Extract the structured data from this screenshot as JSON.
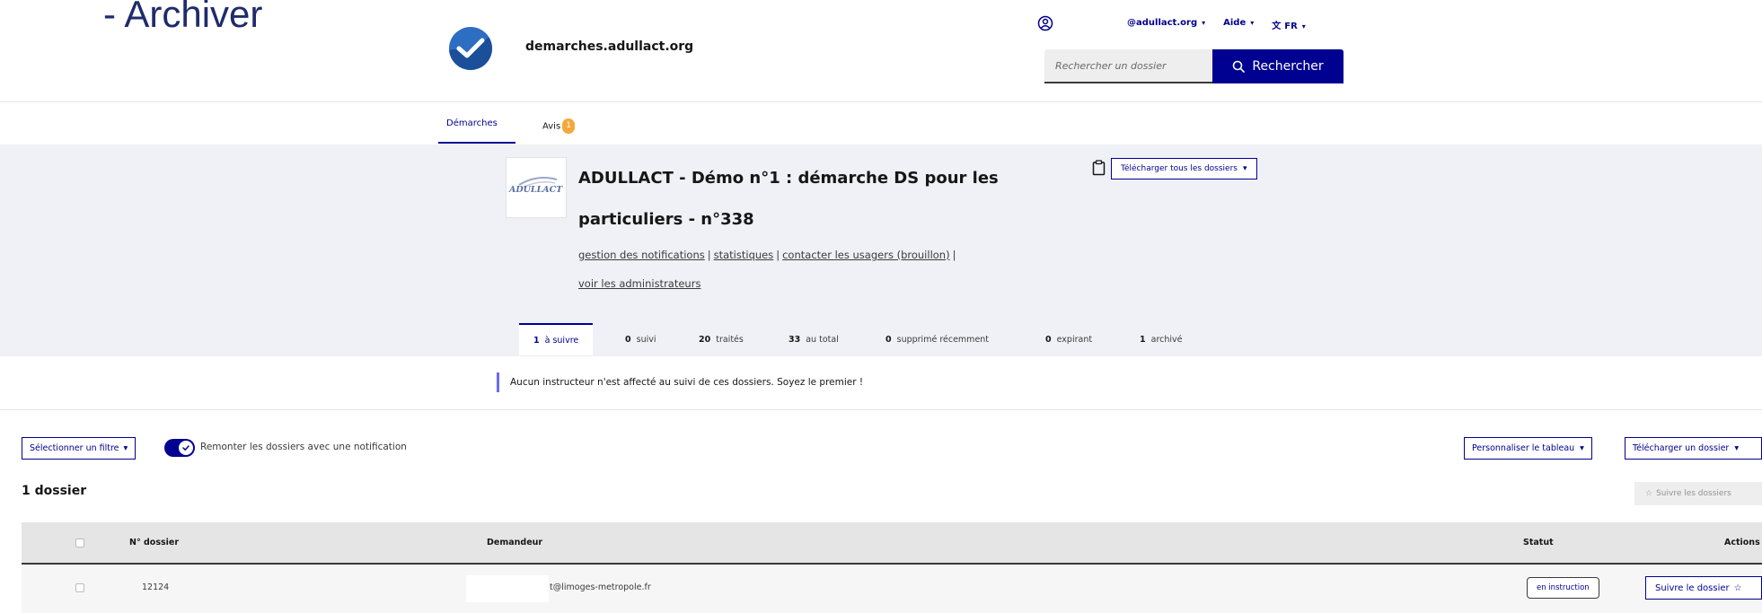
{
  "slide": {
    "title": "- Archiver"
  },
  "header": {
    "site_name": "demarches.adullact.org",
    "account_menu": "@adullact.org",
    "help_menu": "Aide",
    "language_menu": "FR",
    "search": {
      "placeholder": "Rechercher un dossier",
      "button_label": "Rechercher"
    }
  },
  "nav": {
    "tabs": [
      {
        "label": "Démarches",
        "active": true
      },
      {
        "label": "Avis",
        "badge": "1"
      }
    ]
  },
  "procedure": {
    "logo_text": "ADULLACT",
    "title": "ADULLACT - Démo n°1 : démarche DS pour les particuliers - n°338",
    "links": [
      "gestion des notifications",
      "statistiques",
      "contacter les usagers (brouillon)",
      "voir les administrateurs"
    ],
    "download_all_label": "Télécharger tous les dossiers"
  },
  "filter_tabs": [
    {
      "count": "1",
      "label": "à suivre",
      "active": true
    },
    {
      "count": "0",
      "label": "suivi"
    },
    {
      "count": "20",
      "label": "traités"
    },
    {
      "count": "33",
      "label": "au total"
    },
    {
      "count": "0",
      "label": "supprimé récemment"
    },
    {
      "count": "0",
      "label": "expirant"
    },
    {
      "count": "1",
      "label": "archivé"
    }
  ],
  "notice": "Aucun instructeur n'est affecté au suivi de ces dossiers. Soyez le premier !",
  "controls": {
    "filter_button": "Sélectionner un filtre",
    "toggle_label": "Remonter les dossiers avec une notification",
    "customize_button": "Personnaliser le tableau",
    "download_button": "Télécharger un dossier"
  },
  "list": {
    "count_title": "1 dossier",
    "follow_all_button": "Suivre les dossiers",
    "columns": {
      "number": "N° dossier",
      "applicant": "Demandeur",
      "status": "Statut",
      "actions": "Actions"
    },
    "rows": [
      {
        "number": "12124",
        "applicant": "t@limoges-metropole.fr",
        "status": "en instruction",
        "action": "Suivre le dossier"
      }
    ]
  },
  "colors": {
    "primary": "#000091",
    "band": "#f0f1f6",
    "badge": "#f2a93b",
    "notice_bar": "#6a6af4"
  }
}
